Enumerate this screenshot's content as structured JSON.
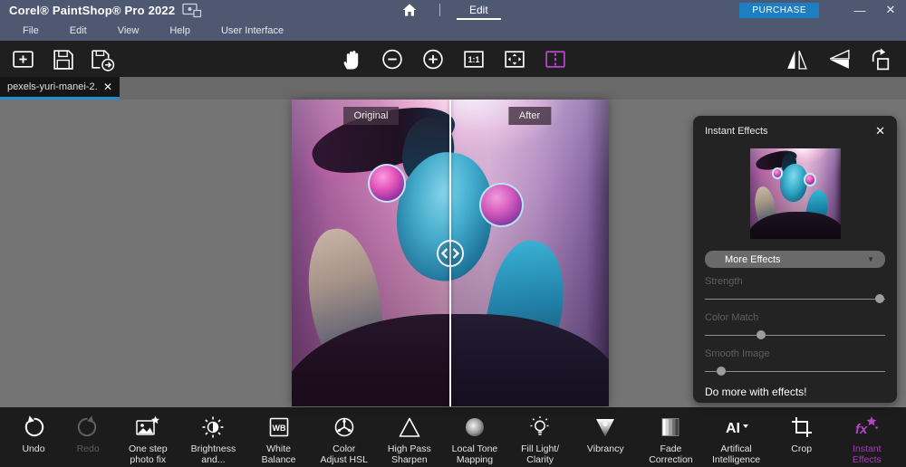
{
  "title_bar": {
    "app_title": "Corel® PaintShop® Pro 2022",
    "active_workspace": "Edit",
    "purchase_label": "PURCHASE",
    "minimize_glyph": "—",
    "close_glyph": "✕"
  },
  "menu_bar": {
    "items": [
      "File",
      "Edit",
      "View",
      "Help",
      "User Interface"
    ]
  },
  "toolbar": {
    "left": [
      {
        "icon": "new-image-icon"
      },
      {
        "icon": "save-icon"
      },
      {
        "icon": "save-export-icon"
      }
    ],
    "center": [
      {
        "icon": "pan-hand-icon"
      },
      {
        "icon": "zoom-out-icon"
      },
      {
        "icon": "zoom-in-icon"
      },
      {
        "icon": "actual-size-icon",
        "glyph": "1:1"
      },
      {
        "icon": "fit-to-window-icon"
      },
      {
        "icon": "before-after-compare-icon",
        "active": true
      }
    ],
    "right": [
      {
        "icon": "mirror-icon"
      },
      {
        "icon": "flip-icon"
      },
      {
        "icon": "rotate-icon"
      }
    ]
  },
  "document_tab": {
    "name": "pexels-yuri-manei-2...",
    "close_glyph": "✕"
  },
  "canvas": {
    "original_label": "Original",
    "after_label": "After"
  },
  "instant_effects_panel": {
    "title": "Instant Effects",
    "close_glyph": "✕",
    "dropdown_label": "More Effects",
    "dropdown_arrow": "▼",
    "sliders": [
      {
        "label": "Strength",
        "value_pct": 97
      },
      {
        "label": "Color Match",
        "value_pct": 31
      },
      {
        "label": "Smooth Image",
        "value_pct": 9
      }
    ],
    "footer_text": "Do more with effects!"
  },
  "bottom_toolbar": {
    "items": [
      {
        "label": "Undo",
        "icon": "undo-icon",
        "enabled": true
      },
      {
        "label": "Redo",
        "icon": "redo-icon",
        "enabled": false
      },
      {
        "label": "One step\nphoto fix",
        "icon": "one-step-photo-fix-icon",
        "enabled": true
      },
      {
        "label": "Brightness\nand...",
        "icon": "brightness-icon",
        "enabled": true
      },
      {
        "label": "White\nBalance",
        "icon": "white-balance-icon",
        "glyph": "WB",
        "enabled": true
      },
      {
        "label": "Color\nAdjust HSL",
        "icon": "color-adjust-hsl-icon",
        "enabled": true
      },
      {
        "label": "High Pass\nSharpen",
        "icon": "high-pass-sharpen-icon",
        "enabled": true
      },
      {
        "label": "Local Tone\nMapping",
        "icon": "local-tone-mapping-icon",
        "enabled": true
      },
      {
        "label": "Fill Light/\nClarity",
        "icon": "fill-light-clarity-icon",
        "enabled": true
      },
      {
        "label": "Vibrancy",
        "icon": "vibrancy-icon",
        "enabled": true
      },
      {
        "label": "Fade\nCorrection",
        "icon": "fade-correction-icon",
        "enabled": true
      },
      {
        "label": "Artifical\nIntelligence",
        "icon": "artificial-intelligence-icon",
        "glyph": "AI",
        "enabled": true
      },
      {
        "label": "Crop",
        "icon": "crop-icon",
        "enabled": true
      },
      {
        "label": "Instant\nEffects",
        "icon": "instant-effects-icon",
        "glyph": "fx",
        "enabled": true,
        "active": true
      }
    ]
  },
  "colors": {
    "titlebar_bg": "#4e5870",
    "purchase_button_bg": "#1d7fc1",
    "tab_accent_blue": "#1e8ed2",
    "accent_purple": "#b445c8",
    "canvas_bg": "#747474",
    "panel_bg": "#232323"
  }
}
